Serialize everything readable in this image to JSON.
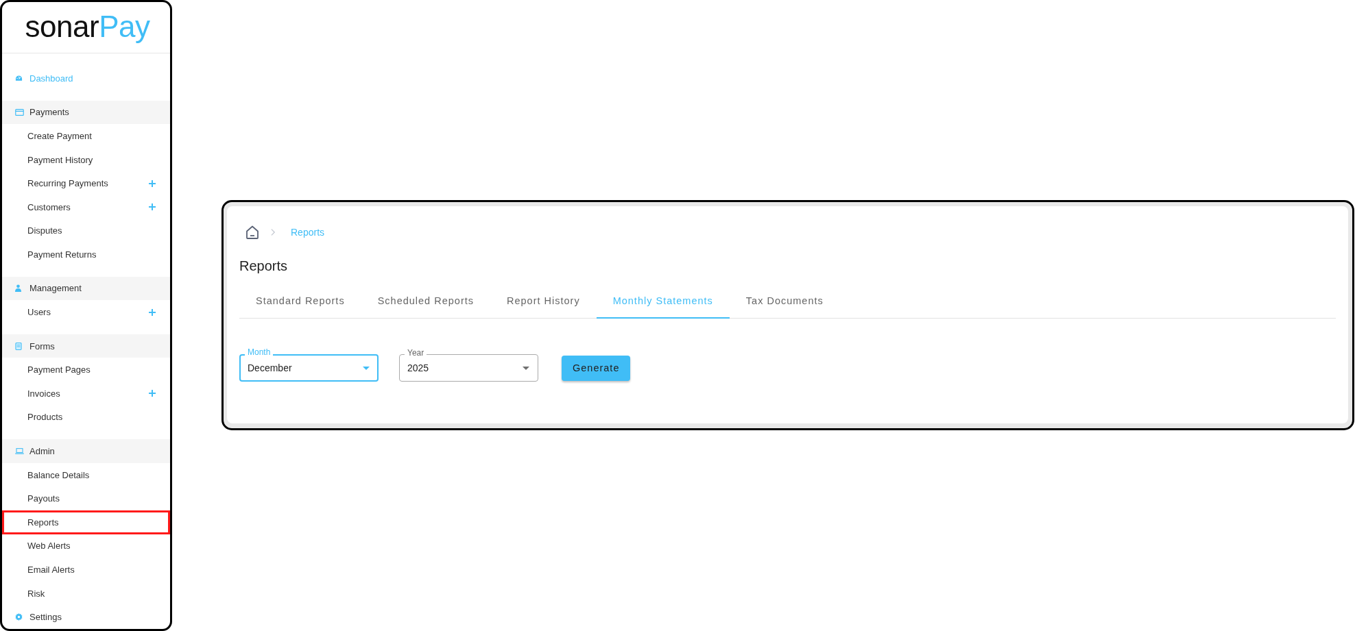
{
  "sidebar": {
    "logo": {
      "part_1": "sonar",
      "part_2": "Pay"
    },
    "items": [
      {
        "kind": "link",
        "label": "Dashboard",
        "active": true,
        "highlighted": false
      },
      {
        "kind": "section",
        "label": "Payments",
        "children": [
          {
            "label": "Create Payment",
            "add": false,
            "highlighted": false
          },
          {
            "label": "Payment History",
            "add": false,
            "highlighted": false
          },
          {
            "label": "Recurring Payments",
            "add": true,
            "highlighted": false
          },
          {
            "label": "Customers",
            "add": true,
            "highlighted": false
          },
          {
            "label": "Disputes",
            "add": false,
            "highlighted": false
          },
          {
            "label": "Payment Returns",
            "add": false,
            "highlighted": false
          }
        ]
      },
      {
        "kind": "section",
        "label": "Management",
        "children": [
          {
            "label": "Users",
            "add": true,
            "highlighted": false
          }
        ]
      },
      {
        "kind": "section",
        "label": "Forms",
        "children": [
          {
            "label": "Payment Pages",
            "add": false,
            "highlighted": false
          },
          {
            "label": "Invoices",
            "add": true,
            "highlighted": false
          },
          {
            "label": "Products",
            "add": false,
            "highlighted": false
          }
        ]
      },
      {
        "kind": "section",
        "label": "Admin",
        "children": [
          {
            "label": "Balance Details",
            "add": false,
            "highlighted": false
          },
          {
            "label": "Payouts",
            "add": false,
            "highlighted": false
          },
          {
            "label": "Reports",
            "add": false,
            "highlighted": true
          },
          {
            "label": "Web Alerts",
            "add": false,
            "highlighted": false
          },
          {
            "label": "Email Alerts",
            "add": false,
            "highlighted": false
          },
          {
            "label": "Risk",
            "add": false,
            "highlighted": false
          }
        ]
      },
      {
        "kind": "link",
        "label": "Settings",
        "active": false,
        "highlighted": false
      }
    ]
  },
  "breadcrumb": {
    "current": "Reports"
  },
  "page_title": "Reports",
  "tabs": [
    {
      "label": "Standard Reports",
      "selected": false
    },
    {
      "label": "Scheduled Reports",
      "selected": false
    },
    {
      "label": "Report History",
      "selected": false
    },
    {
      "label": "Monthly Statements",
      "selected": true
    },
    {
      "label": "Tax Documents",
      "selected": false
    }
  ],
  "form": {
    "fields": [
      {
        "label": "Month",
        "value": "December",
        "focused": true
      },
      {
        "label": "Year",
        "value": "2025",
        "focused": false
      }
    ],
    "button": "Generate"
  }
}
